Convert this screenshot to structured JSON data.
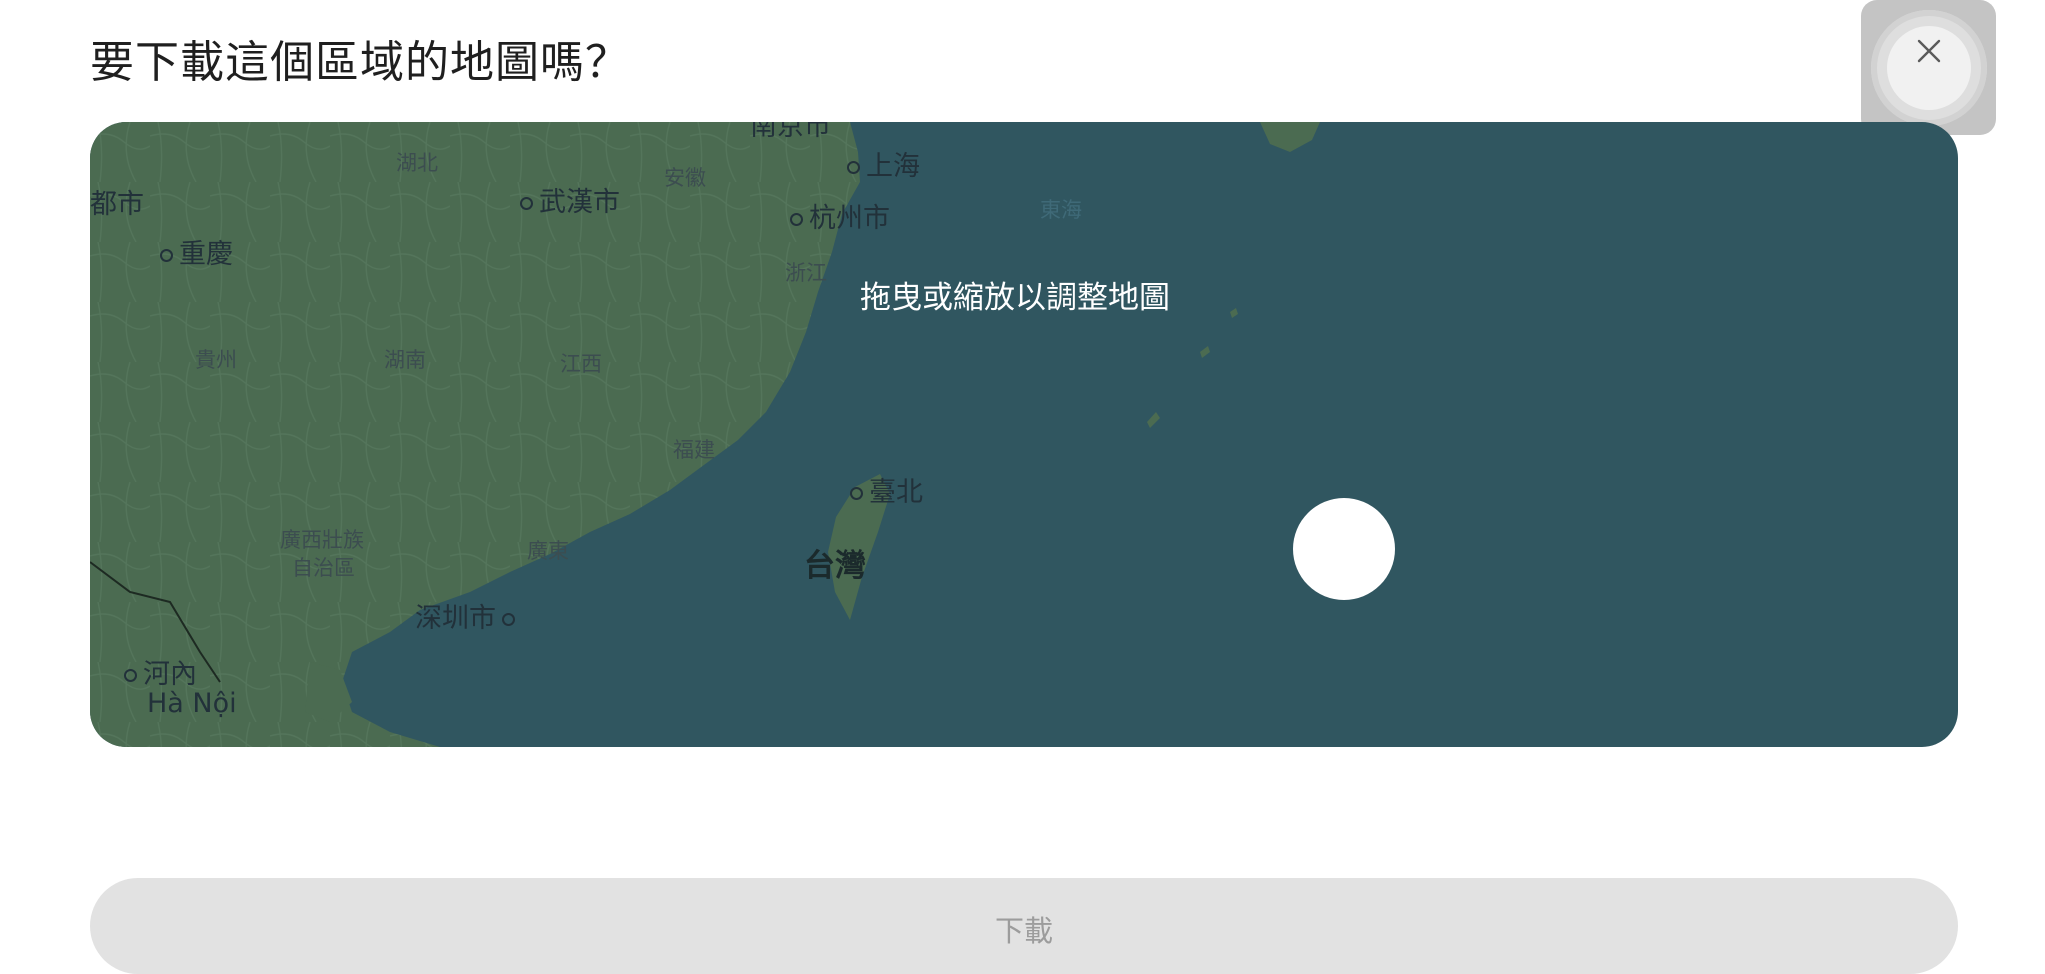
{
  "dialog": {
    "title": "要下載這個區域的地圖嗎？",
    "close_icon": "close-icon",
    "download_label": "下載"
  },
  "map": {
    "hint": "拖曳或縮放以調整地圖",
    "cities": [
      {
        "key": "chengdu",
        "label": "都市"
      },
      {
        "key": "chongqing",
        "label": "重慶"
      },
      {
        "key": "wuhan",
        "label": "武漢市"
      },
      {
        "key": "shanghai",
        "label": "上海"
      },
      {
        "key": "hangzhou",
        "label": "杭州市"
      },
      {
        "key": "nanjing",
        "label": "南京市"
      },
      {
        "key": "taipei",
        "label": "臺北"
      },
      {
        "key": "shenzhen",
        "label": "深圳市"
      },
      {
        "key": "hanoi",
        "label": "河內"
      },
      {
        "key": "hanoi_latin",
        "label": "Hà Nội"
      }
    ],
    "regions": {
      "hubei": "湖北",
      "anhui": "安徽",
      "zhejiang": "浙江",
      "guizhou": "貴州",
      "hunan": "湖南",
      "jiangxi": "江西",
      "fujian": "福建",
      "guangxi_1": "廣西壯族",
      "guangxi_2": "自治區",
      "guangdong": "廣東",
      "taiwan": "台灣",
      "east_sea": "東海"
    },
    "colors": {
      "sea": "#305660",
      "land": "#4a6a50"
    }
  }
}
